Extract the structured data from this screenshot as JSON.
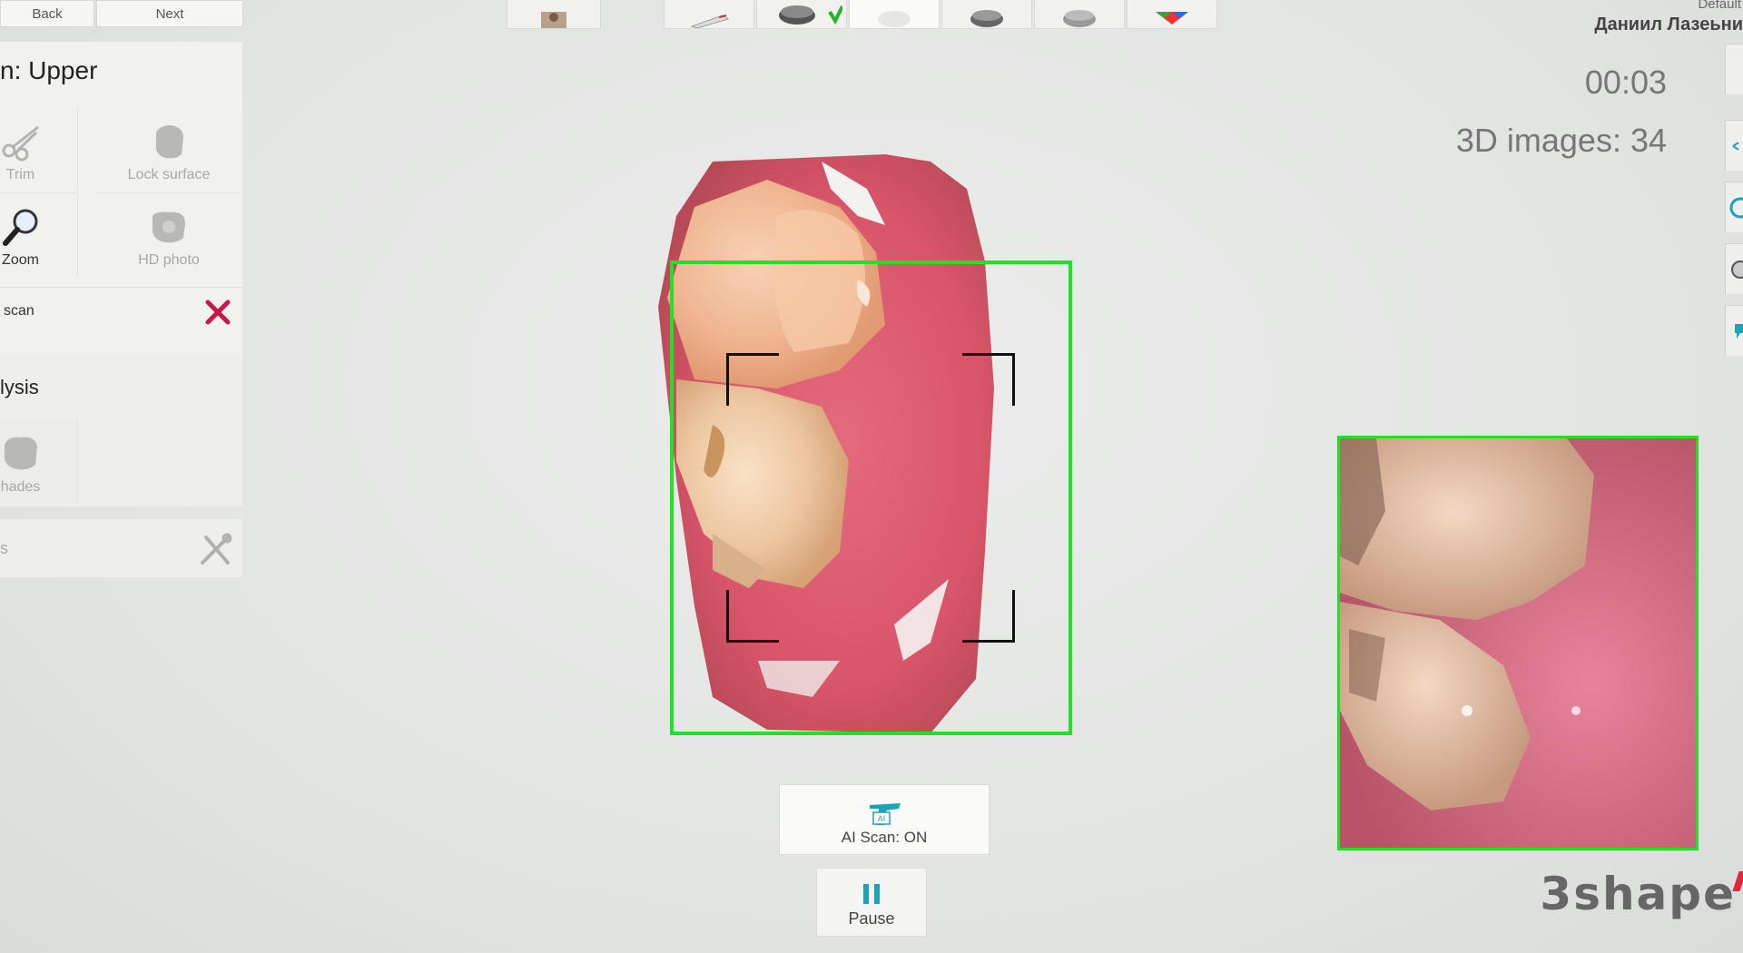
{
  "nav": {
    "back_label": "Back",
    "next_label": "Next"
  },
  "scan_panel": {
    "title": "n: Upper",
    "tools": {
      "trim": "Trim",
      "lock_surface": "Lock surface",
      "zoom": "Zoom",
      "hd_photo": "HD photo"
    },
    "scan_row_label": "scan"
  },
  "analysis_panel": {
    "title": "lysis",
    "shades_label": "hades"
  },
  "tools_panel": {
    "label": "s"
  },
  "user": {
    "role": "Default",
    "name": "Даниил Лазеьни"
  },
  "status": {
    "timer": "00:03",
    "images": "3D images: 34"
  },
  "controls": {
    "ai_scan_label": "AI Scan: ON",
    "ai_badge": "AI",
    "pause_label": "Pause"
  },
  "brand": {
    "logo": "3shape"
  },
  "colors": {
    "frame": "#22e026",
    "delete_red": "#c8174a",
    "ai_icon": "#1ba3b7",
    "pause_icon": "#1ba3b7"
  }
}
